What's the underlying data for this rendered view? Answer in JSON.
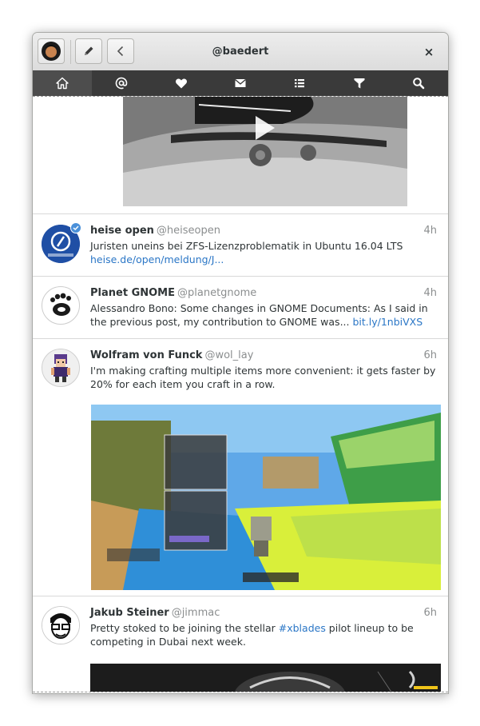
{
  "header": {
    "title": "@baedert",
    "avatar_icon": "user-avatar",
    "compose_icon": "pencil-icon",
    "back_icon": "chevron-left-icon",
    "close_label": "×"
  },
  "tabs": [
    {
      "icon": "home-icon",
      "active": true
    },
    {
      "icon": "mentions-icon",
      "active": false
    },
    {
      "icon": "favorites-icon",
      "active": false
    },
    {
      "icon": "messages-icon",
      "active": false
    },
    {
      "icon": "lists-icon",
      "active": false
    },
    {
      "icon": "filters-icon",
      "active": false
    },
    {
      "icon": "search-icon",
      "active": false
    }
  ],
  "timeline": [
    {
      "display_name": "heise open",
      "handle": "@heiseopen",
      "time": "4h",
      "text": "Juristen uneins bei ZFS-Lizenzproblematik in Ubuntu 16.04 LTS ",
      "link": "heise.de/open/meldung/J..."
    },
    {
      "display_name": "Planet GNOME",
      "handle": "@planetgnome",
      "time": "4h",
      "text": "Alessandro Bono: Some changes in GNOME Documents: As I said in the previous post, my contribution to GNOME was... ",
      "link": "bit.ly/1nbiVXS"
    },
    {
      "display_name": "Wolfram von Funck",
      "handle": "@wol_lay",
      "time": "6h",
      "text": "I'm making crafting multiple items more convenient: it gets faster by 20% for each item you craft in a row."
    },
    {
      "display_name": "Jakub Steiner",
      "handle": "@jimmac",
      "time": "6h",
      "text_before": "Pretty stoked to be joining the stellar ",
      "hashtag": "#xblades",
      "text_after": " pilot lineup to be competing in Dubai next week."
    }
  ],
  "colors": {
    "link": "#2a76c6",
    "tabbar": "#3a3a3a",
    "tab_active": "#4d4d4d"
  }
}
